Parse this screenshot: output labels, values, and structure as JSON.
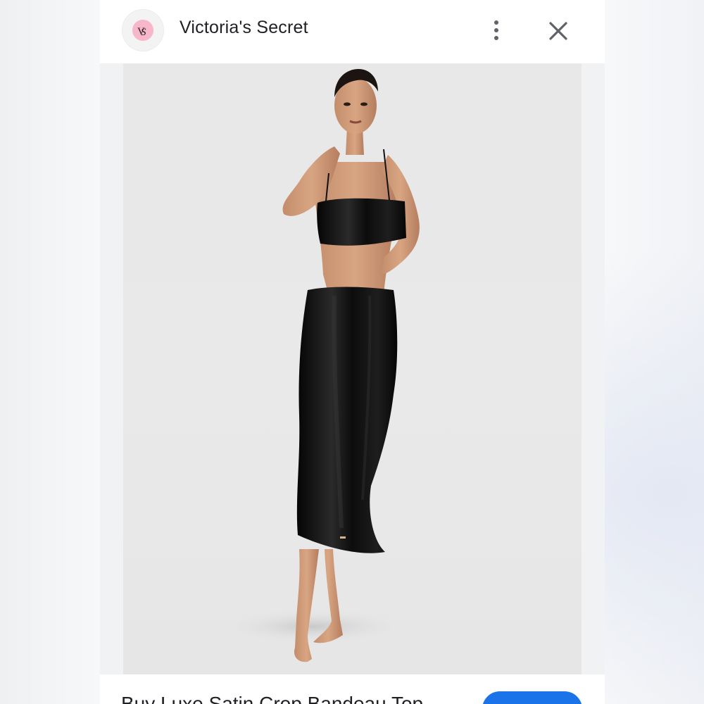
{
  "header": {
    "site_name": "Victoria's Secret",
    "logo_icon": "vs-monogram-icon",
    "more_icon": "more-vert-icon",
    "close_icon": "close-icon"
  },
  "image": {
    "subject": "model in black satin bandeau top and black satin midi skirt"
  },
  "footer": {
    "product_title": "Buy Luxe Satin Crop Bandeau Top"
  },
  "colors": {
    "logo_pink": "#f7b6c9",
    "accent_blue": "#1a73e8",
    "text": "#202124",
    "icon_gray": "#5f6368"
  }
}
